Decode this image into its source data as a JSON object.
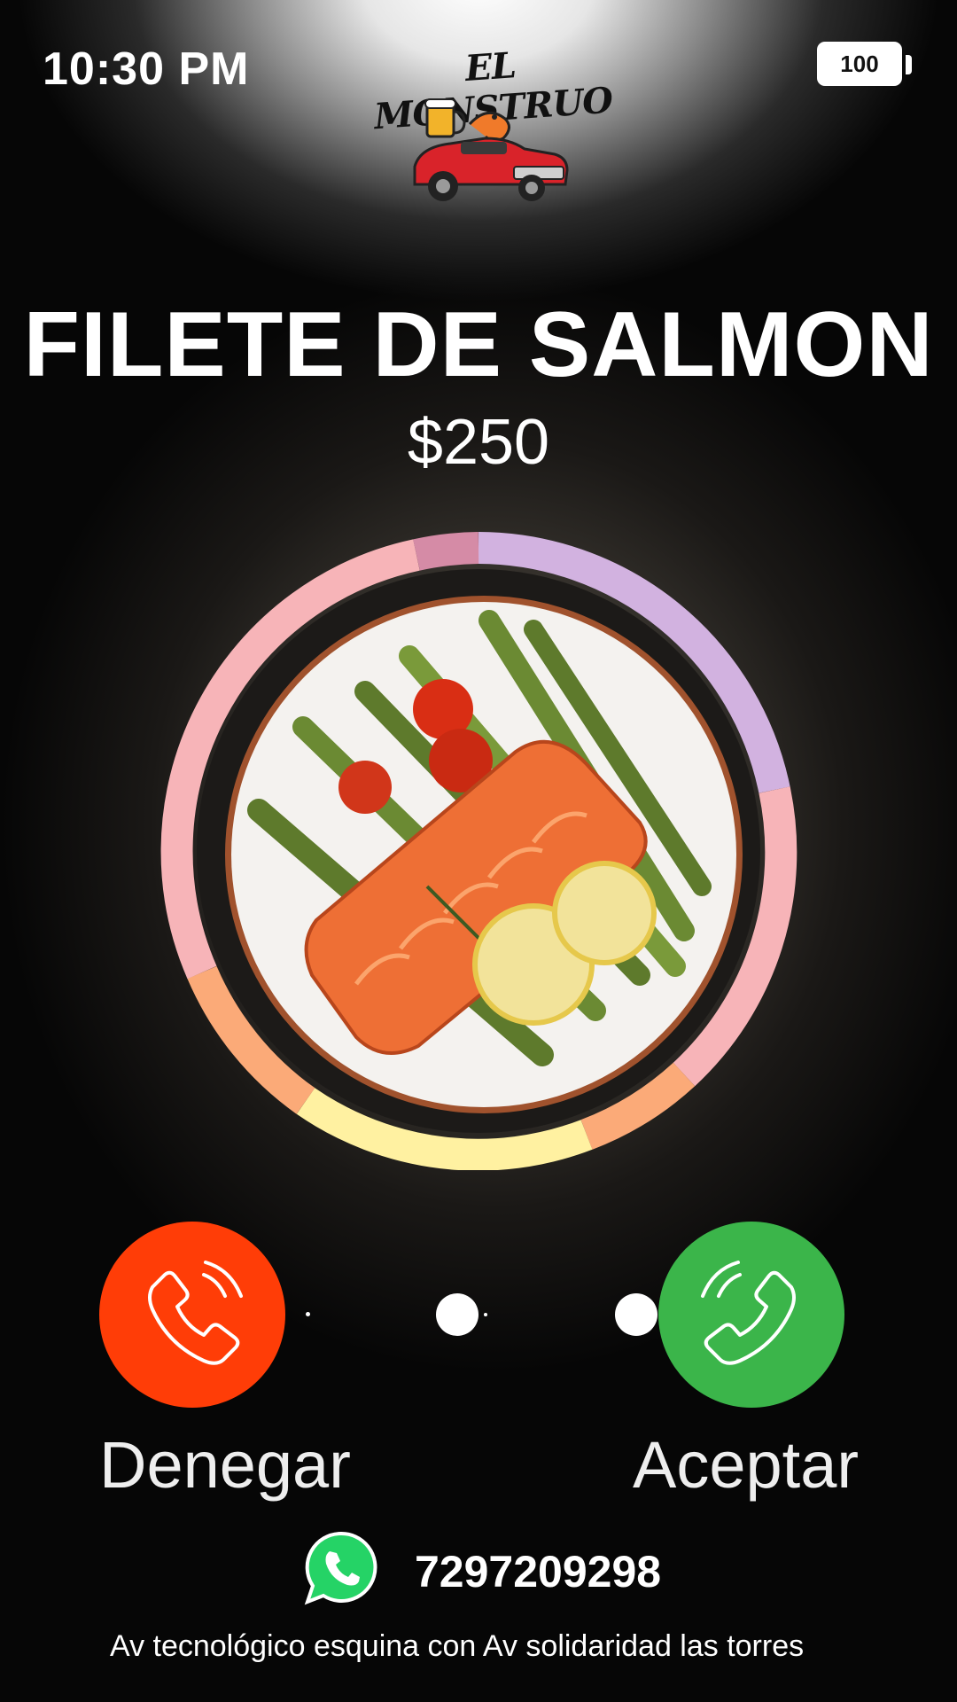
{
  "status_bar": {
    "time": "10:30 PM",
    "battery": "100"
  },
  "logo": {
    "text": "EL MONSTRUO"
  },
  "item": {
    "name": "FILETE DE SALMON",
    "price": "$250"
  },
  "actions": {
    "deny_label": "Denegar",
    "accept_label": "Aceptar"
  },
  "contact": {
    "phone": "7297209298",
    "address": "Av tecnológico esquina con Av solidaridad las torres"
  },
  "colors": {
    "deny": "#ff3d07",
    "accept": "#3bb54a",
    "ring_pink": "#f7b4b8",
    "ring_purple": "#d2b2e0",
    "ring_orange": "#fbaa78",
    "ring_yellow": "#fff1a1"
  }
}
